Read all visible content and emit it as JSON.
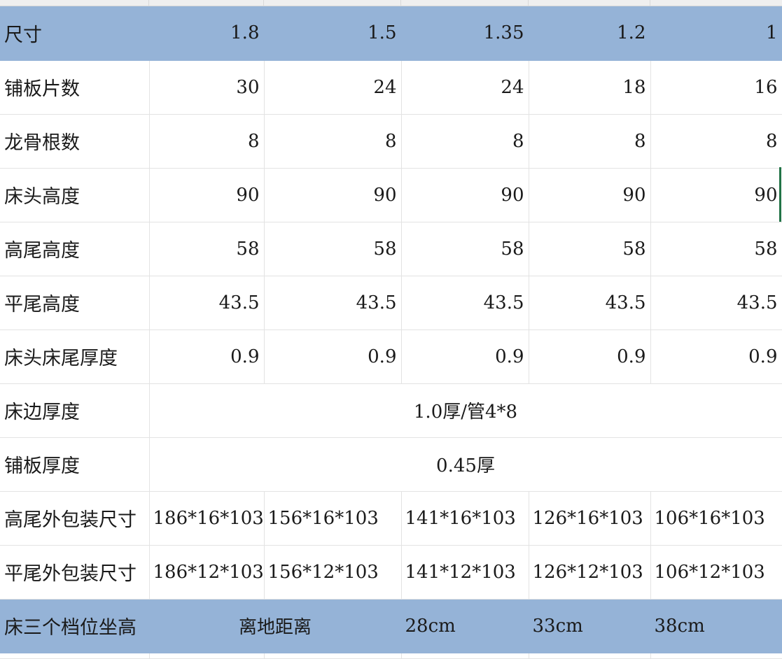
{
  "sheet": {
    "header_row": {
      "label": "尺寸",
      "values": [
        "1.8",
        "1.5",
        "1.35",
        "1.2",
        "1"
      ]
    },
    "rows": [
      {
        "label": "铺板片数",
        "values": [
          "30",
          "24",
          "24",
          "18",
          "16"
        ]
      },
      {
        "label": "龙骨根数",
        "values": [
          "8",
          "8",
          "8",
          "8",
          "8"
        ]
      },
      {
        "label": "床头高度",
        "values": [
          "90",
          "90",
          "90",
          "90",
          "90"
        ]
      },
      {
        "label": "高尾高度",
        "values": [
          "58",
          "58",
          "58",
          "58",
          "58"
        ]
      },
      {
        "label": "平尾高度",
        "values": [
          "43.5",
          "43.5",
          "43.5",
          "43.5",
          "43.5"
        ]
      },
      {
        "label": "床头床尾厚度",
        "values": [
          "0.9",
          "0.9",
          "0.9",
          "0.9",
          "0.9"
        ]
      }
    ],
    "merged_rows": [
      {
        "label": "床边厚度",
        "value": "1.0厚/管4*8"
      },
      {
        "label": "铺板厚度",
        "value": "0.45厚"
      }
    ],
    "package_rows": [
      {
        "label": "高尾外包装尺寸",
        "values": [
          "186*16*103",
          "156*16*103",
          "141*16*103",
          "126*16*103",
          "106*16*103"
        ]
      },
      {
        "label": "平尾外包装尺寸",
        "values": [
          "186*12*103",
          "156*12*103",
          "141*12*103",
          "126*12*103",
          "106*12*103"
        ]
      }
    ],
    "footer_row": {
      "label": "床三个档位坐高",
      "col1": "离地距离",
      "col3": "28cm",
      "col4": "33cm",
      "col5": "38cm"
    },
    "colors": {
      "header_fill": "#95b3d7",
      "grid_line": "#e3e3e3",
      "selection": "#217346"
    }
  }
}
